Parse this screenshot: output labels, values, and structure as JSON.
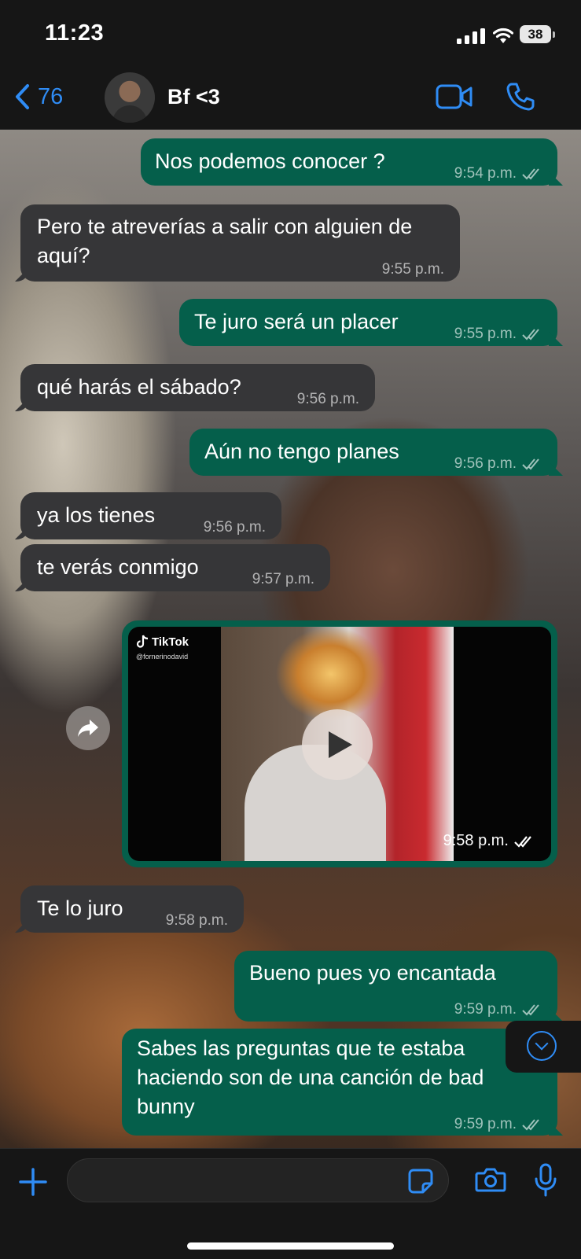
{
  "status": {
    "time": "11:23",
    "battery": "38"
  },
  "header": {
    "back_count": "76",
    "contact_name": "Bf <3"
  },
  "messages": [
    {
      "dir": "out",
      "text": "Nos podemos conocer ?",
      "time": "9:54 p.m."
    },
    {
      "dir": "in",
      "text": "Pero te atreverías a salir con alguien de aquí?",
      "time": "9:55 p.m."
    },
    {
      "dir": "out",
      "text": "Te juro será un placer",
      "time": "9:55 p.m."
    },
    {
      "dir": "in",
      "text": "qué harás el sábado?",
      "time": "9:56 p.m."
    },
    {
      "dir": "out",
      "text": "Aún no tengo planes",
      "time": "9:56 p.m."
    },
    {
      "dir": "in",
      "text": "ya los tienes",
      "time": "9:56 p.m."
    },
    {
      "dir": "in",
      "text": "te verás conmigo",
      "time": "9:57 p.m."
    },
    {
      "dir": "in",
      "text": "Te lo juro",
      "time": "9:58 p.m."
    },
    {
      "dir": "out",
      "text": "Bueno pues yo encantada",
      "time": "9:59 p.m."
    },
    {
      "dir": "out",
      "text": "Sabes las preguntas que te estaba haciendo son de una canción de bad bunny",
      "time": "9:59 p.m."
    }
  ],
  "video_message": {
    "dir": "out",
    "source": "TikTok",
    "user": "@fornerinodavid",
    "time": "9:58 p.m."
  },
  "composer": {
    "placeholder": ""
  },
  "colors": {
    "accent": "#2f8cf5",
    "outgoing_bubble": "#055f4b",
    "incoming_bubble": "#363638"
  }
}
